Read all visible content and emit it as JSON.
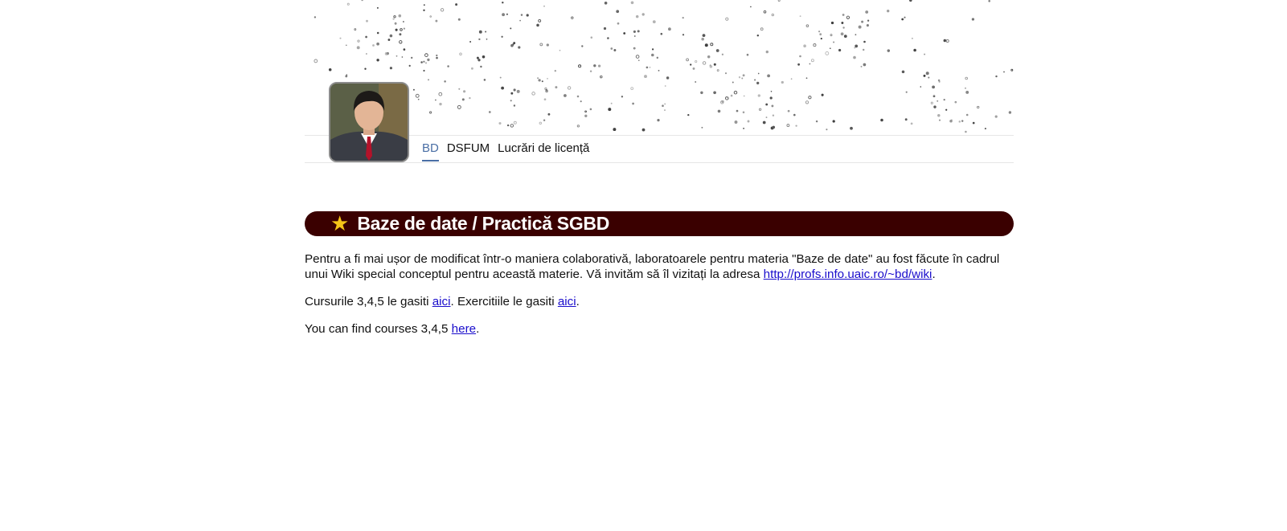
{
  "header": {
    "nav": [
      {
        "label": "BD",
        "active": true
      },
      {
        "label": "DSFUM",
        "active": false
      },
      {
        "label": "Lucrări de licență",
        "active": false
      }
    ]
  },
  "section": {
    "title": "Baze de date / Practică SGBD",
    "star_icon": "★"
  },
  "content": {
    "p1_text": "Pentru a fi mai ușor de modificat într-o maniera colaborativă, laboratoarele pentru materia \"Baze de date\" au fost făcute în cadrul unui Wiki special conceptul pentru această materie. Vă invităm să îl vizitați la adresa ",
    "p1_link": "http://profs.info.uaic.ro/~bd/wiki",
    "p1_end": ".",
    "p2_text1": "Cursurile 3,4,5 le gasiti ",
    "p2_link1": "aici",
    "p2_text2": ". Exercitiile le gasiti ",
    "p2_link2": "aici",
    "p2_end": ".",
    "p3_text": "You can find courses 3,4,5 ",
    "p3_link": "here",
    "p3_end": "."
  },
  "colors": {
    "title_bar": "#3a0000",
    "star": "#f5c518",
    "nav_active": "#4a6fa5",
    "link": "#1a0dcc"
  }
}
